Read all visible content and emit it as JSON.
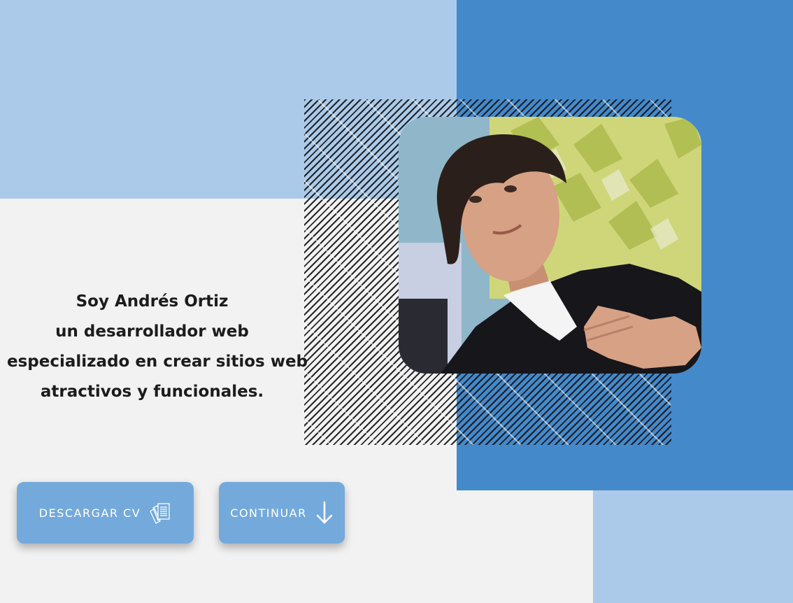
{
  "hero": {
    "intro_lines": [
      "Soy Andrés Ortiz",
      "un desarrollador web",
      "especializado en crear sitios web",
      "atractivos y funcionales."
    ]
  },
  "buttons": {
    "download_cv": {
      "label": "DESCARGAR CV",
      "icon": "documents-icon"
    },
    "continue": {
      "label": "CONTINUAR",
      "icon": "arrow-down-icon"
    }
  },
  "colors": {
    "background": "#f2f2f2",
    "light_blue": "#abcae9",
    "blue": "#4489ca",
    "button": "#74a9dc",
    "text": "#1c1c1c"
  }
}
